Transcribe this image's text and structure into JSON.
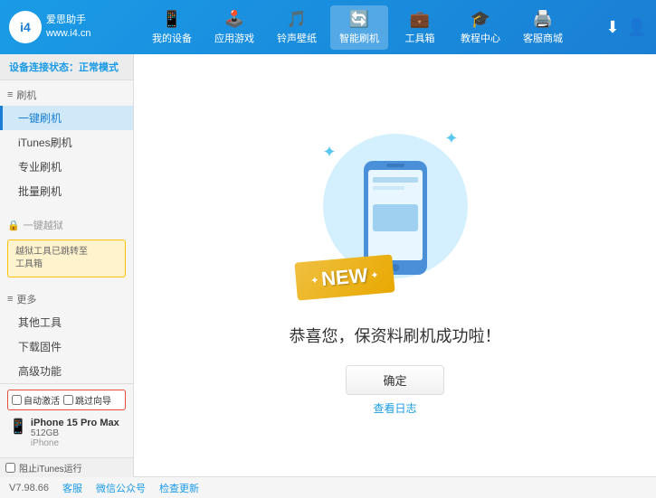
{
  "header": {
    "logo_short": "i4",
    "logo_text_line1": "爱思助手",
    "logo_text_line2": "www.i4.cn",
    "nav_items": [
      {
        "id": "my-device",
        "label": "我的设备",
        "icon": "📱"
      },
      {
        "id": "app-game",
        "label": "应用游戏",
        "icon": "👤"
      },
      {
        "id": "ringtone",
        "label": "铃声壁纸",
        "icon": "🎵"
      },
      {
        "id": "smart-flash",
        "label": "智能刷机",
        "icon": "🔄",
        "active": true
      },
      {
        "id": "toolbox",
        "label": "工具箱",
        "icon": "💼"
      },
      {
        "id": "tutorial",
        "label": "教程中心",
        "icon": "🎓"
      },
      {
        "id": "service",
        "label": "客服商城",
        "icon": "🖨️"
      }
    ],
    "download_icon": "⬇",
    "user_icon": "👤"
  },
  "sidebar": {
    "status_label": "设备连接状态：",
    "status_value": "正常模式",
    "sections": [
      {
        "header": "刷机",
        "header_icon": "📋",
        "items": [
          {
            "label": "一键刷机",
            "active": true
          },
          {
            "label": "iTunes刷机"
          },
          {
            "label": "专业刷机"
          },
          {
            "label": "批量刷机"
          }
        ]
      }
    ],
    "disabled_label": "一键越狱",
    "notice_line1": "越狱工具已跳转至",
    "notice_line2": "工具箱",
    "more_label": "更多",
    "more_items": [
      {
        "label": "其他工具"
      },
      {
        "label": "下载固件"
      },
      {
        "label": "高级功能"
      }
    ],
    "auto_activate_label": "自动激活",
    "skip_guide_label": "跳过向导",
    "device_name": "iPhone 15 Pro Max",
    "device_storage": "512GB",
    "device_type": "iPhone",
    "itunes_label": "阻止iTunes运行"
  },
  "content": {
    "new_text": "NEW",
    "success_text": "恭喜您，保资料刷机成功啦！",
    "confirm_button": "确定",
    "log_button": "查看日志"
  },
  "footer": {
    "version": "V7.98.66",
    "links": [
      "客服",
      "微信公众号",
      "检查更新"
    ]
  }
}
